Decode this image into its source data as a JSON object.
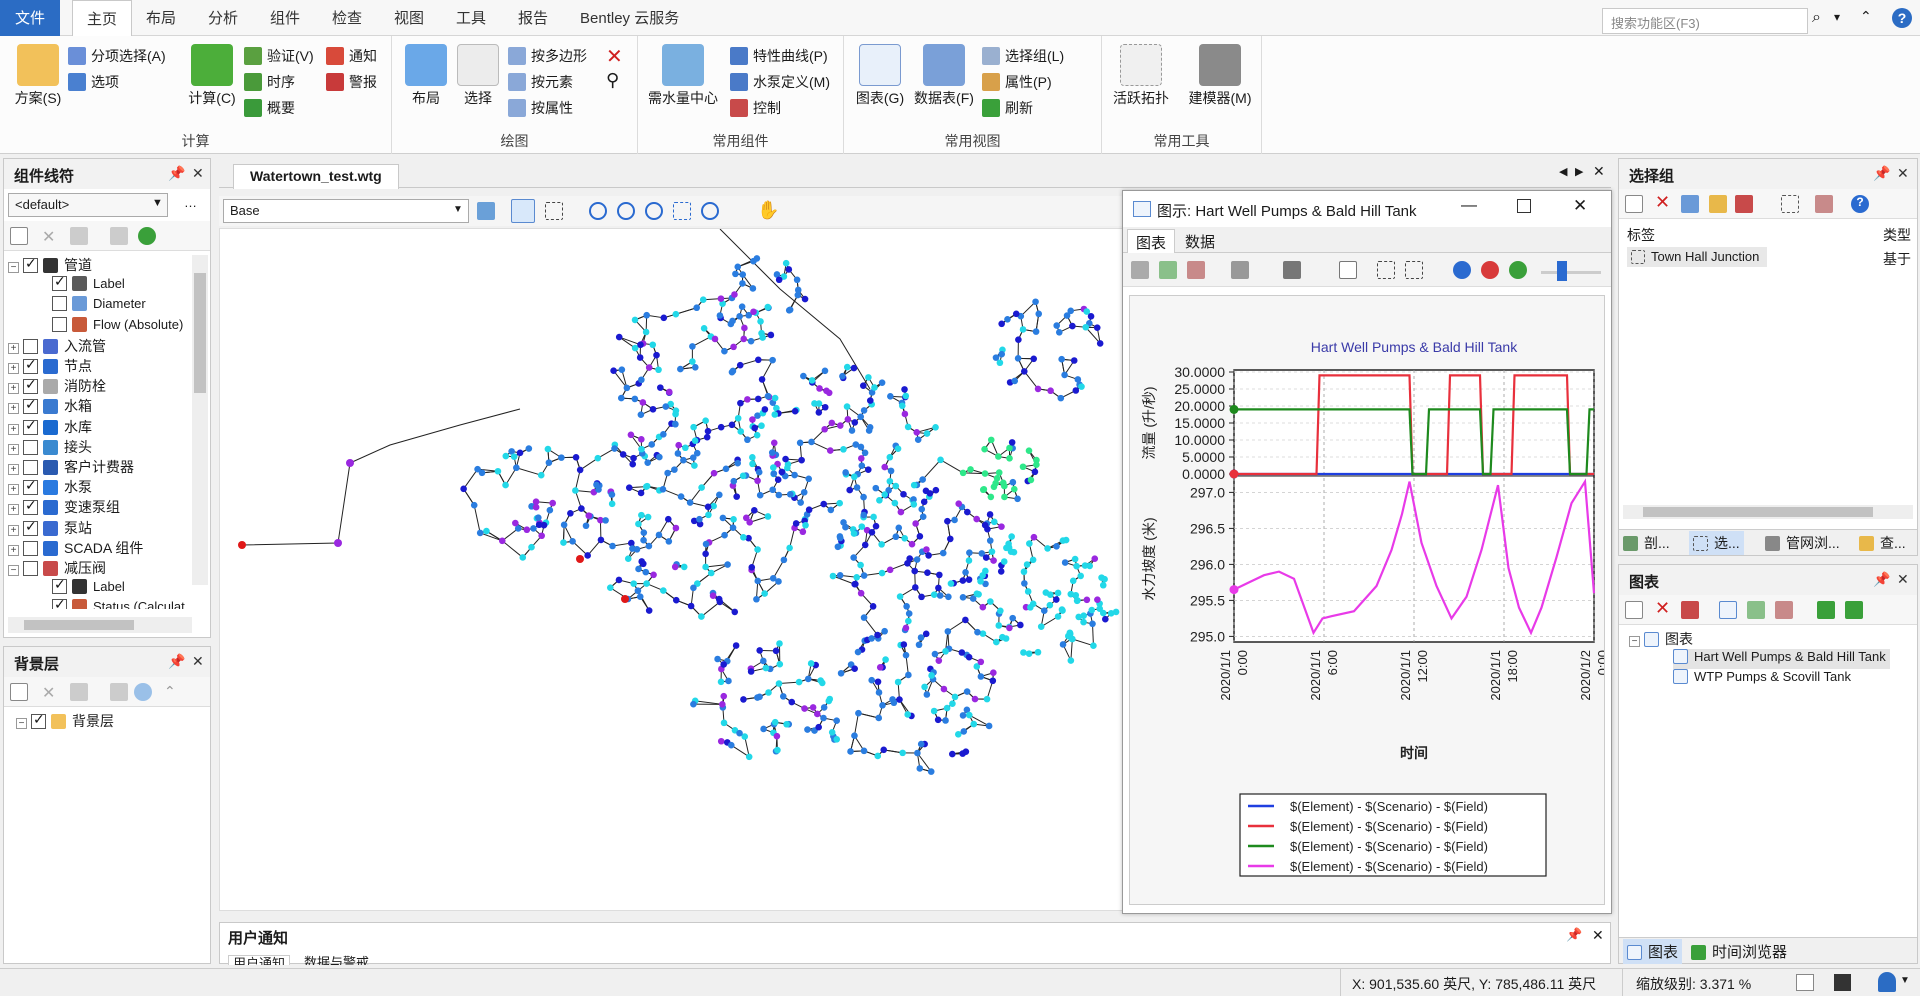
{
  "menu": {
    "tabs": [
      "文件",
      "主页",
      "布局",
      "分析",
      "组件",
      "检查",
      "视图",
      "工具",
      "报告",
      "Bentley 云服务"
    ],
    "search_placeholder": "搜索功能区(F3)"
  },
  "ribbon": {
    "groups": {
      "calc": "计算",
      "draw": "绘图",
      "common_components": "常用组件",
      "common_views": "常用视图",
      "common_tools": "常用工具"
    },
    "buttons": {
      "scheme": "方案(S)",
      "sub_select": "分项选择(A)",
      "options": "选项",
      "compute": "计算(C)",
      "validate": "验证(V)",
      "timing": "时序",
      "overview": "概要",
      "notify": "通知",
      "alarm": "警报",
      "layout": "布局",
      "select": "选择",
      "by_polygon": "按多边形",
      "by_element": "按元素",
      "by_property": "按属性",
      "demand_center": "需水量中心",
      "char_curve": "特性曲线(P)",
      "pump_def": "水泵定义(M)",
      "control": "控制",
      "graph": "图表(G)",
      "datatable": "数据表(F)",
      "select_group": "选择组(L)",
      "properties": "属性(P)",
      "refresh": "刷新",
      "active_topology": "活跃拓扑",
      "modeler": "建模器(M)"
    }
  },
  "element_symbology": {
    "title": "组件线符",
    "dropdown": "<default>",
    "tree": [
      {
        "label": "管道",
        "checked": true,
        "expanded": true,
        "level": 0
      },
      {
        "label": "Label",
        "checked": true,
        "level": 1
      },
      {
        "label": "Diameter",
        "checked": false,
        "level": 1
      },
      {
        "label": "Flow (Absolute)",
        "checked": false,
        "level": 1
      },
      {
        "label": "入流管",
        "checked": false,
        "level": 0
      },
      {
        "label": "节点",
        "checked": true,
        "level": 0
      },
      {
        "label": "消防栓",
        "checked": true,
        "level": 0
      },
      {
        "label": "水箱",
        "checked": true,
        "level": 0
      },
      {
        "label": "水库",
        "checked": true,
        "level": 0
      },
      {
        "label": "接头",
        "checked": false,
        "level": 0
      },
      {
        "label": "客户计费器",
        "checked": false,
        "level": 0
      },
      {
        "label": "水泵",
        "checked": true,
        "level": 0
      },
      {
        "label": "变速泵组",
        "checked": true,
        "level": 0
      },
      {
        "label": "泵站",
        "checked": true,
        "level": 0
      },
      {
        "label": "SCADA 组件",
        "checked": false,
        "level": 0
      },
      {
        "label": "减压阀",
        "checked": false,
        "expanded": true,
        "level": 0
      },
      {
        "label": "Label",
        "checked": true,
        "level": 1
      },
      {
        "label": "Status (Calculat",
        "checked": true,
        "level": 1
      }
    ]
  },
  "background_layers": {
    "title": "背景层",
    "tree": [
      {
        "label": "背景层",
        "checked": true
      }
    ]
  },
  "document": {
    "tab": "Watertown_test.wtg",
    "scenario": "Base"
  },
  "graph_window": {
    "title": "图示: Hart Well Pumps & Bald Hill Tank",
    "tabs": [
      "图表",
      "数据"
    ]
  },
  "chart_data": {
    "type": "line",
    "title": "Hart Well Pumps & Bald Hill Tank",
    "xlabel": "时间",
    "x_ticks": [
      "2020/1/1 0:00",
      "2020/1/1 6:00",
      "2020/1/1 12:00",
      "2020/1/1 18:00",
      "2020/1/2 0:00"
    ],
    "x_range_hours": [
      0,
      24
    ],
    "panels": [
      {
        "ylabel": "流量 (升/秒)",
        "y_ticks": [
          "0.0000",
          "5.0000",
          "10.0000",
          "15.0000",
          "20.0000",
          "25.0000",
          "30.0000"
        ],
        "ylim": [
          0,
          30
        ],
        "series": [
          {
            "color": "#1f3fe0",
            "hours": [
              0,
              24
            ],
            "values": [
              0,
              0
            ]
          },
          {
            "color": "#e8303c",
            "hours": [
              0,
              5.5,
              5.7,
              11.7,
              11.9,
              14.2,
              14.4,
              16.4,
              16.6,
              18.5,
              18.7,
              22.2,
              22.4,
              24
            ],
            "values": [
              0,
              0,
              29,
              29,
              0,
              0,
              29,
              29,
              0,
              0,
              29,
              29,
              0,
              0
            ]
          },
          {
            "color": "#1e8a1e",
            "hours": [
              0,
              11.7,
              11.9,
              12.8,
              13.0,
              16.4,
              16.6,
              17.1,
              17.3,
              22.2,
              22.4,
              23.5,
              23.7,
              24
            ],
            "values": [
              19,
              19,
              0,
              0,
              19,
              19,
              0,
              0,
              19,
              19,
              0,
              0,
              19,
              19
            ]
          }
        ]
      },
      {
        "ylabel": "水力坡度 (米)",
        "y_ticks": [
          "295.0",
          "295.5",
          "296.0",
          "296.5",
          "297.0"
        ],
        "ylim": [
          294.95,
          297.2
        ],
        "series": [
          {
            "color": "#e83ae8",
            "hours": [
              0,
              1,
              2,
              3,
              4,
              5.3,
              5.9,
              6.5,
              8,
              9.5,
              10.5,
              11.2,
              11.7,
              12.5,
              13.5,
              14.5,
              15.5,
              16.5,
              17.6,
              18.3,
              19,
              19.8,
              20.5,
              21.5,
              22.5,
              23.4,
              24
            ],
            "values": [
              295.65,
              295.75,
              295.85,
              295.9,
              295.8,
              295.05,
              295.25,
              295.28,
              295.35,
              295.7,
              296.2,
              296.7,
              297.15,
              296.3,
              295.7,
              295.25,
              295.55,
              296.2,
              297.1,
              295.95,
              295.4,
              295.05,
              295.4,
              296.1,
              296.85,
              297.15,
              295.6
            ]
          }
        ]
      }
    ],
    "legend": [
      {
        "label": "$(Element) - $(Scenario) - $(Field)",
        "color": "#1f3fe0"
      },
      {
        "label": "$(Element) - $(Scenario) - $(Field)",
        "color": "#e8303c"
      },
      {
        "label": "$(Element) - $(Scenario) - $(Field)",
        "color": "#1e8a1e"
      },
      {
        "label": "$(Element) - $(Scenario) - $(Field)",
        "color": "#e83ae8"
      }
    ]
  },
  "selection_sets": {
    "title": "选择组",
    "col_label": "标签",
    "col_type": "类型",
    "rows": [
      {
        "label": "Town Hall Junction",
        "type": "基于"
      }
    ],
    "bottom_tabs": [
      "剖...",
      "选...",
      "管网浏...",
      "查..."
    ]
  },
  "graphs_panel": {
    "title": "图表",
    "root": "图表",
    "items": [
      "Hart Well Pumps & Bald Hill Tank",
      "WTP Pumps & Scovill Tank"
    ],
    "bottom_tabs": [
      "图表",
      "时间浏览器"
    ]
  },
  "user_notifications": {
    "title": "用户通知",
    "tabs": [
      "用户通知",
      "数据与警戒"
    ]
  },
  "status": {
    "coords": "X: 901,535.60 英尺,  Y: 785,486.11 英尺",
    "zoom": "缩放级别: 3.371 %"
  },
  "colors": {
    "accent": "#2b6cc4",
    "node_dark_blue": "#1a1ad0",
    "node_blue": "#2a7de0",
    "node_cyan": "#22d8e8",
    "node_green": "#2ee88a",
    "node_purple": "#9a28e0",
    "node_red": "#e01818"
  }
}
